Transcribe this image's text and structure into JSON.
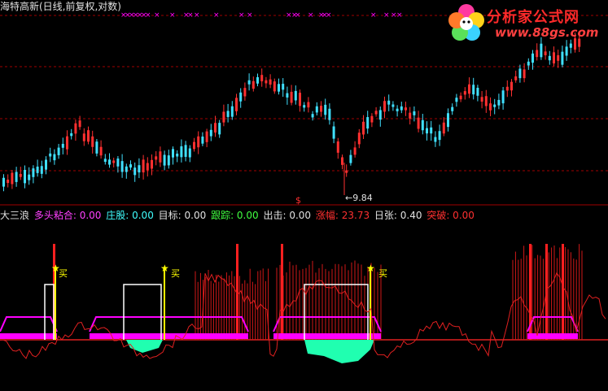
{
  "window": {
    "title": "海特高新(日线,前复权,对数)"
  },
  "logo": {
    "line1": "分析家公式网",
    "line2": "www.88gs.com"
  },
  "price_chart": {
    "low_marker": "←9.84",
    "dollar_marker": "$"
  },
  "indicator": {
    "items": [
      {
        "label": "大三浪",
        "color": "#e0e0e0"
      },
      {
        "label": "多头粘合: 0.00",
        "color": "#ff40ff"
      },
      {
        "label": "庄股: 0.00",
        "color": "#40ffff"
      },
      {
        "label": "目标: 0.00",
        "color": "#e0e0e0"
      },
      {
        "label": "跟踪: 0.00",
        "color": "#40ff40"
      },
      {
        "label": "出击: 0.00",
        "color": "#e0e0e0"
      },
      {
        "label": "涨幅: 23.73",
        "color": "#ff3030"
      },
      {
        "label": "日张: 0.40",
        "color": "#e0e0e0"
      },
      {
        "label": "突破: 0.00",
        "color": "#ff3030"
      }
    ],
    "buy_signals": [
      "买",
      "买",
      "买"
    ]
  },
  "colors": {
    "up_candle": "#ff3030",
    "down_candle": "#40e0ff",
    "grid": "#a00000",
    "magenta": "#ff00ff",
    "yellow": "#ffff00",
    "cyan_area": "#20ffb0"
  }
}
